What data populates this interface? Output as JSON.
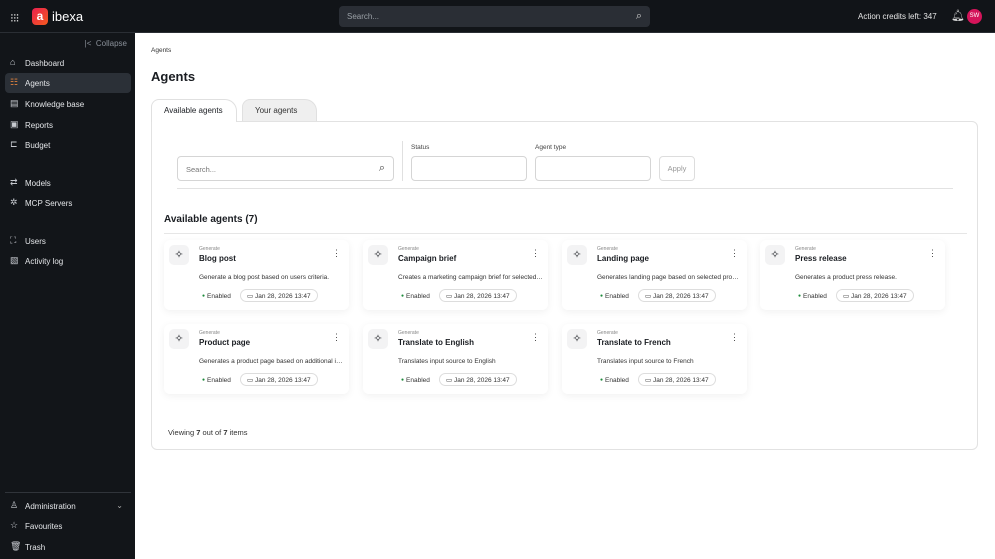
{
  "topbar": {
    "brand": "ibexa",
    "logo_letter": "a",
    "search_placeholder": "Search...",
    "credits": "Action credits left: 347",
    "avatar": "SW"
  },
  "sidebar": {
    "collapse": "Collapse",
    "items": [
      {
        "label": "Dashboard",
        "icon": "home-icon"
      },
      {
        "label": "Agents",
        "icon": "agents-icon",
        "active": true
      },
      {
        "label": "Knowledge base",
        "icon": "database-icon"
      },
      {
        "label": "Reports",
        "icon": "clipboard-icon"
      },
      {
        "label": "Budget",
        "icon": "cart-icon"
      },
      {
        "label": "Models",
        "icon": "arrows-icon"
      },
      {
        "label": "MCP Servers",
        "icon": "network-icon"
      },
      {
        "label": "Users",
        "icon": "users-icon"
      },
      {
        "label": "Activity log",
        "icon": "log-icon"
      }
    ],
    "bottom": [
      {
        "label": "Administration",
        "icon": "admin-icon"
      },
      {
        "label": "Favourites",
        "icon": "star-icon"
      },
      {
        "label": "Trash",
        "icon": "trash-icon"
      }
    ]
  },
  "breadcrumb": "Agents",
  "title": "Agents",
  "tabs": [
    "Available agents",
    "Your agents"
  ],
  "filters": {
    "search_placeholder": "Search...",
    "status_label": "Status",
    "status_value": "",
    "type_label": "Agent type",
    "type_value": "",
    "apply": "Apply"
  },
  "section_title": "Available agents (7)",
  "cards": [
    {
      "category": "Generate",
      "title": "Blog post",
      "desc": "Generate a blog post based on users criteria.",
      "status": "Enabled",
      "date": "Jan 28, 2026 13:47"
    },
    {
      "category": "Generate",
      "title": "Campaign brief",
      "desc": "Creates a marketing campaign brief for selected products",
      "status": "Enabled",
      "date": "Jan 28, 2026 13:47"
    },
    {
      "category": "Generate",
      "title": "Landing page",
      "desc": "Generates landing page based on selected products",
      "status": "Enabled",
      "date": "Jan 28, 2026 13:47"
    },
    {
      "category": "Generate",
      "title": "Press release",
      "desc": "Generates a product press release.",
      "status": "Enabled",
      "date": "Jan 28, 2026 13:47"
    },
    {
      "category": "Generate",
      "title": "Product page",
      "desc": "Generates a product page based on additional information",
      "status": "Enabled",
      "date": "Jan 28, 2026 13:47"
    },
    {
      "category": "Generate",
      "title": "Translate to English",
      "desc": "Translates input source to English",
      "status": "Enabled",
      "date": "Jan 28, 2026 13:47"
    },
    {
      "category": "Generate",
      "title": "Translate to French",
      "desc": "Translates input source to French",
      "status": "Enabled",
      "date": "Jan 28, 2026 13:47"
    }
  ],
  "footer": {
    "prefix": "Viewing",
    "shown": "7",
    "middle": "out of",
    "total": "7",
    "suffix": "items"
  },
  "colors": {
    "accent": "#e0823d",
    "brand": "#e8204f",
    "status_enabled": "#1c8a3a"
  }
}
